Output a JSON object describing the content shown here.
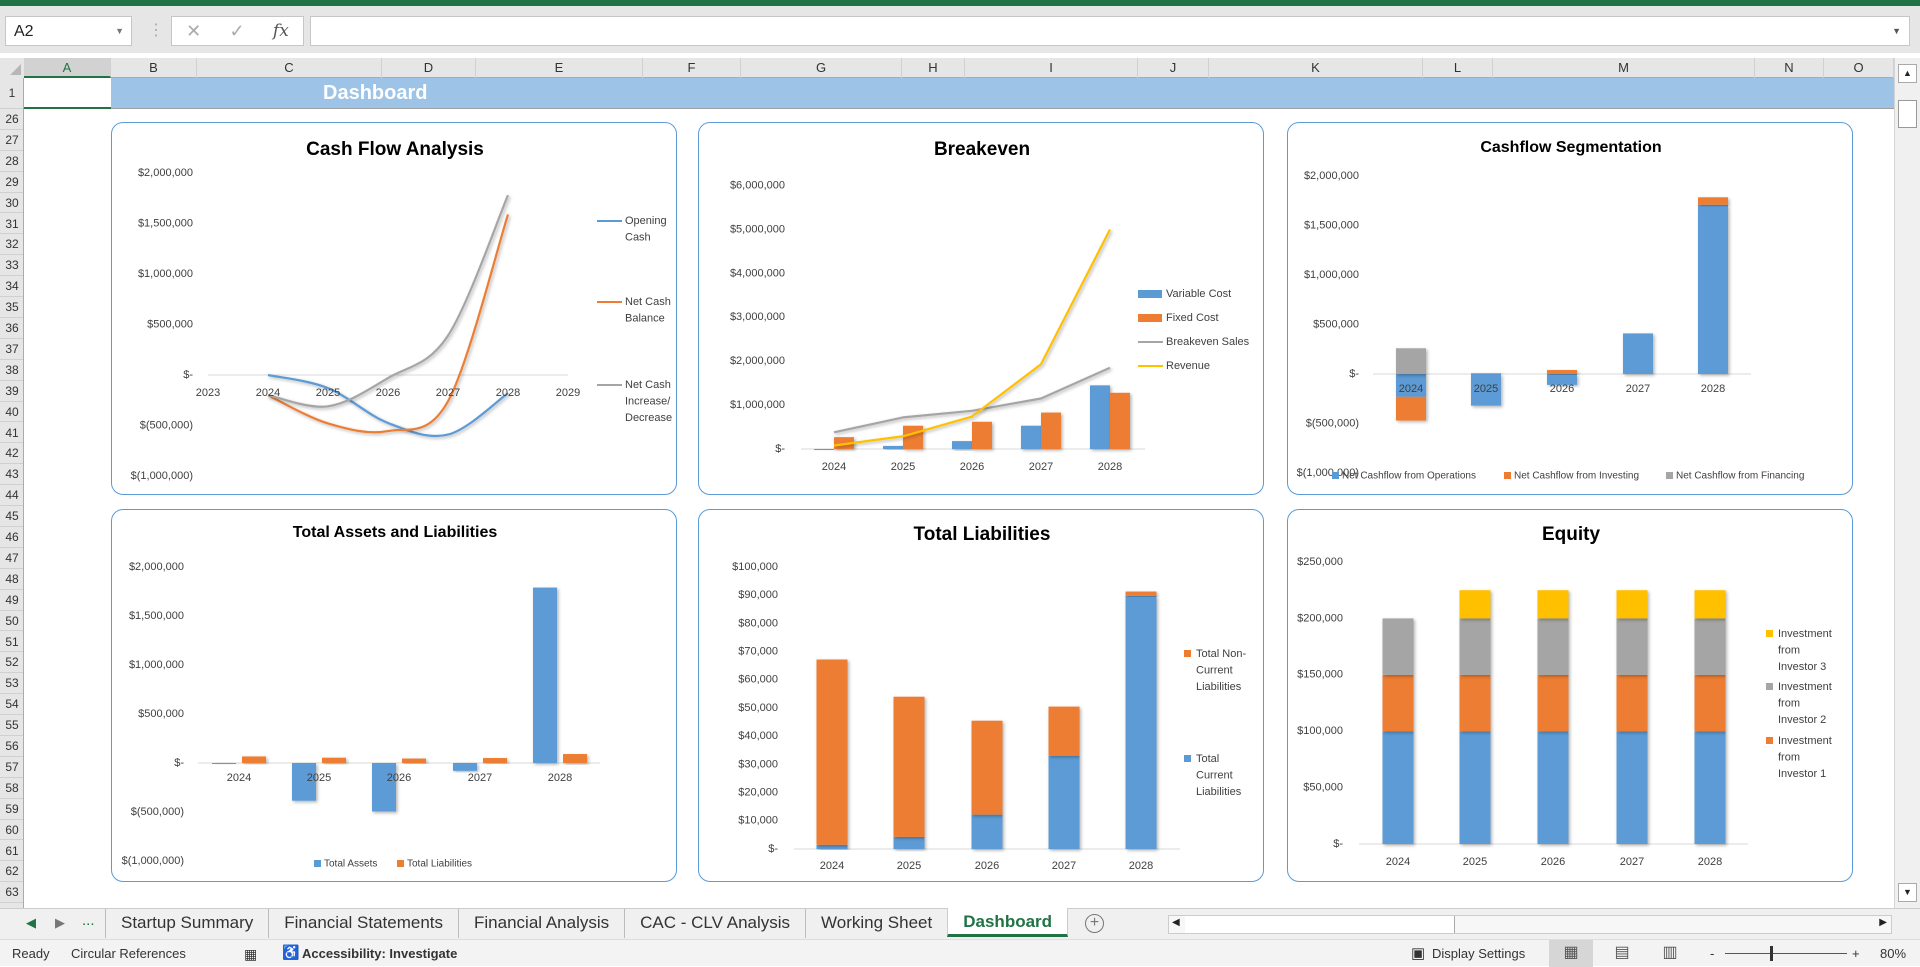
{
  "app": {
    "accent": "#217346"
  },
  "formula_bar": {
    "name_box": "A2",
    "cancel_icon": "✕",
    "enter_icon": "✓",
    "fx_label": "fx",
    "formula": ""
  },
  "columns": [
    "A",
    "B",
    "C",
    "D",
    "E",
    "F",
    "G",
    "H",
    "I",
    "J",
    "K",
    "L",
    "M",
    "N",
    "O"
  ],
  "rows": [
    "1",
    "26",
    "27",
    "28",
    "29",
    "30",
    "31",
    "32",
    "33",
    "34",
    "35",
    "36",
    "37",
    "38",
    "39",
    "40",
    "41",
    "42",
    "43",
    "44",
    "45",
    "46",
    "47",
    "48",
    "49",
    "50",
    "51",
    "52",
    "53",
    "54",
    "55",
    "56",
    "57",
    "58",
    "59",
    "60",
    "61",
    "62",
    "63"
  ],
  "sheet": {
    "banner_title": "Dashboard"
  },
  "colors": {
    "blue": "#5B9BD5",
    "orange": "#ED7D31",
    "gray": "#A5A5A5",
    "yellow": "#FFC000",
    "banner": "#9DC3E6"
  },
  "chart_data": [
    {
      "type": "line",
      "title": "Cash Flow Analysis",
      "x_ticks": [
        "2023",
        "2024",
        "2025",
        "2026",
        "2027",
        "2028",
        "2029"
      ],
      "categories": [
        "2024",
        "2025",
        "2026",
        "2027",
        "2028"
      ],
      "yticks": [
        2000000,
        1500000,
        1000000,
        500000,
        0,
        -500000,
        -1000000
      ],
      "ytick_labels": [
        "$2,000,000",
        "$1,500,000",
        "$1,000,000",
        "$500,000",
        "$-",
        "$(500,000)",
        "$(1,000,000)"
      ],
      "ylim": [
        -1000000,
        2000000
      ],
      "smooth": true,
      "legend": "right",
      "series": [
        {
          "name": "Opening Cash",
          "color": "#5B9BD5",
          "values": [
            0,
            -130000,
            -475000,
            -590000,
            -180000
          ]
        },
        {
          "name": "Net Cash Balance",
          "color": "#ED7D31",
          "values": [
            -200000,
            -480000,
            -555000,
            -260000,
            1590000
          ]
        },
        {
          "name": "Net Cash Increase/Decrease",
          "color": "#A5A5A5",
          "values": [
            -200000,
            -310000,
            -30000,
            390000,
            1780000
          ]
        }
      ]
    },
    {
      "type": "bar+line",
      "title": "Breakeven",
      "categories": [
        "2024",
        "2025",
        "2026",
        "2027",
        "2028"
      ],
      "yticks": [
        6000000,
        5000000,
        4000000,
        3000000,
        2000000,
        1000000,
        0
      ],
      "ytick_labels": [
        "$6,000,000",
        "$5,000,000",
        "$4,000,000",
        "$3,000,000",
        "$2,000,000",
        "$1,000,000",
        "$-"
      ],
      "ylim": [
        0,
        6000000
      ],
      "legend": "right",
      "series": [
        {
          "name": "Variable Cost",
          "kind": "bar",
          "color": "#5B9BD5",
          "values": [
            0,
            70000,
            180000,
            530000,
            1450000
          ]
        },
        {
          "name": "Fixed Cost",
          "kind": "bar",
          "color": "#ED7D31",
          "values": [
            270000,
            530000,
            620000,
            830000,
            1280000
          ]
        },
        {
          "name": "Breakeven Sales",
          "kind": "line",
          "color": "#A5A5A5",
          "values": [
            380000,
            720000,
            870000,
            1150000,
            1850000
          ]
        },
        {
          "name": "Revenue",
          "kind": "line",
          "color": "#FFC000",
          "values": [
            80000,
            290000,
            740000,
            1930000,
            5000000
          ]
        }
      ]
    },
    {
      "type": "stacked-bar",
      "title": "Cashflow Segmentation",
      "categories": [
        "2024",
        "2025",
        "2026",
        "2027",
        "2028"
      ],
      "yticks": [
        2000000,
        1500000,
        1000000,
        500000,
        0,
        -500000,
        -1000000
      ],
      "ytick_labels": [
        "$2,000,000",
        "$1,500,000",
        "$1,000,000",
        "$500,000",
        "$-",
        "$(500,000)",
        "$(1,000,000)"
      ],
      "ylim": [
        -1000000,
        2000000
      ],
      "legend": "bottom",
      "series": [
        {
          "name": "Net Cashflow from Operations",
          "color": "#5B9BD5",
          "values": [
            -230000,
            -320000,
            -110000,
            410000,
            1710000
          ]
        },
        {
          "name": "Net Cashflow from Investing",
          "color": "#ED7D31",
          "values": [
            -240000,
            0,
            40000,
            0,
            75000
          ]
        },
        {
          "name": "Net Cashflow from Financing",
          "color": "#A5A5A5",
          "values": [
            260000,
            10000,
            0,
            0,
            0
          ]
        }
      ]
    },
    {
      "type": "bar",
      "title": "Total Assets and Liabilities",
      "categories": [
        "2024",
        "2025",
        "2026",
        "2027",
        "2028"
      ],
      "yticks": [
        2000000,
        1500000,
        1000000,
        500000,
        0,
        -500000,
        -1000000
      ],
      "ytick_labels": [
        "$2,000,000",
        "$1,500,000",
        "$1,000,000",
        "$500,000",
        "$-",
        "$(500,000)",
        "$(1,000,000)"
      ],
      "ylim": [
        -1000000,
        2000000
      ],
      "legend": "bottom",
      "series": [
        {
          "name": "Total Assets",
          "color": "#5B9BD5",
          "values": [
            -10000,
            -385000,
            -495000,
            -80000,
            1790000
          ]
        },
        {
          "name": "Total Liabilities",
          "color": "#ED7D31",
          "values": [
            67000,
            54000,
            45500,
            50500,
            91300
          ]
        }
      ]
    },
    {
      "type": "stacked-bar",
      "title": "Total Liabilities",
      "categories": [
        "2024",
        "2025",
        "2026",
        "2027",
        "2028"
      ],
      "yticks": [
        100000,
        90000,
        80000,
        70000,
        60000,
        50000,
        40000,
        30000,
        20000,
        10000,
        0
      ],
      "ytick_labels": [
        "$100,000",
        "$90,000",
        "$80,000",
        "$70,000",
        "$60,000",
        "$50,000",
        "$40,000",
        "$30,000",
        "$20,000",
        "$10,000",
        "$-"
      ],
      "ylim": [
        0,
        100000
      ],
      "legend": "right",
      "series": [
        {
          "name": "Total Current Liabilities",
          "color": "#5B9BD5",
          "values": [
            1500,
            4300,
            12200,
            33100,
            89800
          ]
        },
        {
          "name": "Total Non-Current Liabilities",
          "color": "#ED7D31",
          "values": [
            65700,
            49700,
            33300,
            17400,
            1500
          ]
        }
      ],
      "legend_order": [
        1,
        0
      ]
    },
    {
      "type": "stacked-bar",
      "title": "Equity",
      "categories": [
        "2024",
        "2025",
        "2026",
        "2027",
        "2028"
      ],
      "yticks": [
        250000,
        200000,
        150000,
        100000,
        50000,
        0
      ],
      "ytick_labels": [
        "$250,000",
        "$200,000",
        "$150,000",
        "$100,000",
        "$50,000",
        "$-"
      ],
      "ylim": [
        0,
        250000
      ],
      "legend": "right",
      "series": [
        {
          "color": "#5B9BD5",
          "values": [
            100000,
            100000,
            100000,
            100000,
            100000
          ]
        },
        {
          "name": "Investment from Investor 1",
          "color": "#ED7D31",
          "values": [
            50000,
            50000,
            50000,
            50000,
            50000
          ]
        },
        {
          "name": "Investment from Investor 2",
          "color": "#A5A5A5",
          "values": [
            50000,
            50000,
            50000,
            50000,
            50000
          ]
        },
        {
          "name": "Investment from Investor 3",
          "color": "#FFC000",
          "values": [
            0,
            25000,
            25000,
            25000,
            25000
          ]
        }
      ],
      "legend_order": [
        3,
        2,
        1
      ]
    }
  ],
  "tabs": {
    "nav_prev": "◀",
    "nav_next": "▶",
    "more": "...",
    "items": [
      "Startup Summary",
      "Financial Statements",
      "Financial Analysis",
      "CAC - CLV Analysis",
      "Working Sheet",
      "Dashboard"
    ],
    "active": "Dashboard",
    "add": "+"
  },
  "status": {
    "ready": "Ready",
    "circular": "Circular References",
    "accessibility": "Accessibility: Investigate",
    "display_settings": "Display Settings",
    "zoom": "80%",
    "zoom_minus": "-",
    "zoom_plus": "+",
    "zoom_percent": 80
  }
}
